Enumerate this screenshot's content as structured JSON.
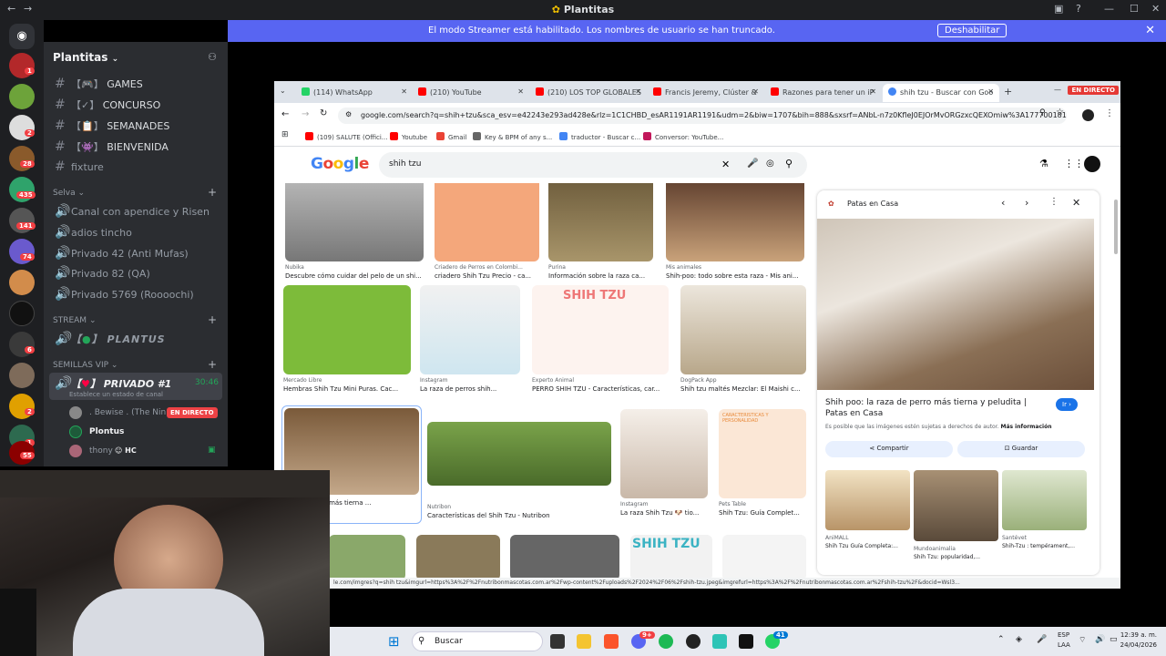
{
  "discord": {
    "window_title": "Plantitas",
    "streamer_banner": "El modo Streamer está habilitado. Los nombres de usuario se han truncado.",
    "streamer_disable": "Deshabilitar",
    "guild_name": "Plantitas",
    "channels_top": [
      {
        "name": "GAMES",
        "prefix": "【🎮】"
      },
      {
        "name": "CONCURSO",
        "prefix": "【✓】"
      },
      {
        "name": "SEMANADES",
        "prefix": "【📋】"
      },
      {
        "name": "BIENVENIDA",
        "prefix": "【👾】"
      },
      {
        "name": "fixture",
        "prefix": ""
      }
    ],
    "category_selva": "Selva",
    "channels_selva": [
      "Canal con apendice y Risen",
      "adios tincho",
      "Privado 42 (Anti Mufas)",
      "Privado 82 (QA)",
      "Privado 5769 (Roooochi)"
    ],
    "category_stream": "STREAM",
    "stream_channel": "PLANTUS",
    "category_semillas": "SEMILLAS VIP",
    "voice_channel": "PRIVADO #1",
    "voice_time": "30:46",
    "voice_status": "Establece un estado de canal",
    "voice_users": [
      {
        "name": ". Bewise . (The Nin...",
        "live": "EN DIRECTO"
      },
      {
        "name": "Plontus",
        "live": ""
      },
      {
        "name": "thony",
        "tag": "HC"
      }
    ],
    "server_badges": [
      "1",
      "2",
      "28",
      "435",
      "141",
      "74",
      "6",
      "2",
      "1",
      "55"
    ],
    "colors": {
      "blurple": "#5865f2",
      "red": "#f23f43",
      "bg_dark": "#1e1f22",
      "bg_channels": "#2b2d31"
    }
  },
  "chrome": {
    "tabs": [
      "(114) WhatsApp",
      "(210) YouTube",
      "(210) LOS TOP GLOBALES",
      "Francis Jeremy, Clúster &",
      "Razones para tener un iP",
      "shih tzu - Buscar con Goo"
    ],
    "live_badge": "EN DIRECTO",
    "url": "google.com/search?q=shih+tzu&sca_esv=e42243e293ad428e&rlz=1C1CHBD_esAR1191AR1191&udm=2&biw=1707&bih=888&sxsrf=ANbL-n7z0KfleJ0EJOrMvORGzxcQEXOmiw%3A1777001817..",
    "bookmarks": [
      "(109) SALUTE (Offici...",
      "Youtube",
      "Gmail",
      "Key & BPM of any s...",
      "traductor - Buscar c...",
      "Conversor: YouTube..."
    ],
    "google_logo": "Google",
    "query": "shih tzu",
    "results_row1": [
      {
        "src": "Nubika",
        "cap": "Descubre cómo cuidar del pelo de un shi..."
      },
      {
        "src": "Criadero de Perros en Colombi...",
        "cap": "criadero Shih Tzu Precio - ca..."
      },
      {
        "src": "Purina",
        "cap": "Información sobre la raza ca..."
      },
      {
        "src": "Mis animales",
        "cap": "Shih-poo: todo sobre esta raza - Mis ani..."
      }
    ],
    "results_row2": [
      {
        "src": "Mercado Libre",
        "cap": "Hembras Shih Tzu Mini Puras. Cac..."
      },
      {
        "src": "Instagram",
        "cap": "La raza de perros shih..."
      },
      {
        "src": "Experto Animal",
        "cap": "PERRO SHIH TZU - Características, car..."
      },
      {
        "src": "DogPack App",
        "cap": "Shih tzu maltés Mezclar: El Maishi c..."
      }
    ],
    "results_row3": [
      {
        "src": "",
        "cap": "raza de perro más tierna ..."
      },
      {
        "src": "Nutribon",
        "cap": "Características del Shih Tzu - Nutribon"
      },
      {
        "src": "Instagram",
        "cap": "La raza Shih Tzu 🐶 tio..."
      },
      {
        "src": "Pets Table",
        "cap": "Shih Tzu: Guía Complet..."
      }
    ],
    "shih_tzu_text": "SHIH TZU",
    "shih_tzu_text2": "SHIH TZU",
    "caracteristicas": "CARACTERISTICAS Y PERSONALIDAD",
    "panel": {
      "source": "Patas en Casa",
      "title": "Shih poo: la raza de perro más tierna y peludita | Patas en Casa",
      "notice": "Es posible que las imágenes estén sujetas a derechos de autor.",
      "more_info": "Más información",
      "go": "Ir",
      "share": "Compartir",
      "save": "Guardar",
      "related": [
        {
          "src": "AniMALL",
          "cap": "Shih Tzu Guía Completa:..."
        },
        {
          "src": "Mundoanimalia",
          "cap": "Shih Tzu: popularidad,..."
        },
        {
          "src": "Santévet",
          "cap": "Shih-Tzu : tempérament,..."
        }
      ]
    },
    "status_url": "le.com/imgres?q=shih tzu&imgurl=https%3A%2F%2Fnutribonmascotas.com.ar%2Fwp-content%2Fuploads%2F2024%2F06%2Fshih-tzu.jpeg&imgrefurl=https%3A%2F%2Fnutribonmascotas.com.ar%2Fshih-tzu%2F&docid=Wsl3..."
  },
  "taskbar": {
    "search": "Buscar",
    "lang": "ESP",
    "lang2": "LAA",
    "time": "12:39 a. m.",
    "date": "24/04/2026",
    "badge_discord": "9+",
    "badge_whatsapp": "41"
  }
}
